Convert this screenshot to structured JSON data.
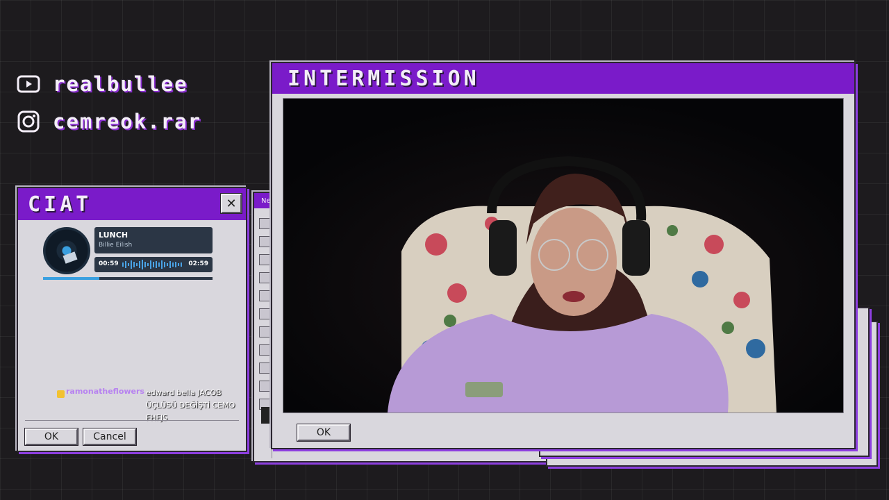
{
  "socials": [
    {
      "platform_icon": "youtube-icon",
      "handle": "realbullee"
    },
    {
      "platform_icon": "instagram-icon",
      "handle": "cemreok.rar"
    }
  ],
  "chat_window": {
    "title": "CIAT",
    "close_glyph": "✕",
    "music": {
      "track_title": "LUNCH",
      "artist": "Billie Eilish",
      "elapsed": "00:59",
      "total": "02:59",
      "progress": 0.33
    },
    "messages": [
      {
        "username": "ramonatheflowers",
        "badge_icon": "smile-badge-icon",
        "text": "edward bella JACOB ÜÇLÜSÜ DEĞİŞTİ CEMO FHFJS"
      }
    ],
    "ok_label": "OK",
    "cancel_label": "Cancel"
  },
  "paint_window": {
    "title_fragment": "Ne",
    "tools": [
      "select-icon",
      "lasso-icon",
      "crop-icon",
      "pencil-icon",
      "fill-icon",
      "eraser-icon",
      "brush-icon",
      "pointer-icon",
      "pen-icon",
      "text-icon",
      "hand-icon"
    ]
  },
  "intermission_window": {
    "title": "INTERMISSION",
    "ok_label": "OK"
  },
  "colors": {
    "accent_purple": "#7a1bc9",
    "window_gray": "#d9d7dd",
    "background": "#1d1b1e"
  }
}
